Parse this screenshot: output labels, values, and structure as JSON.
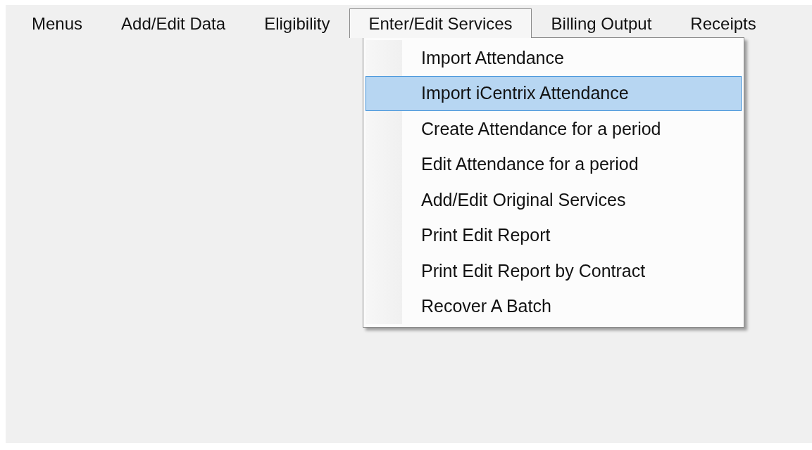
{
  "menu_bar": [
    {
      "label": "Menus",
      "selected": false
    },
    {
      "label": "Add/Edit Data",
      "selected": false
    },
    {
      "label": "Eligibility",
      "selected": false
    },
    {
      "label": "Enter/Edit Services",
      "selected": true
    },
    {
      "label": "Billing Output",
      "selected": false
    },
    {
      "label": "Receipts",
      "selected": false
    }
  ],
  "dropdown": {
    "items": [
      {
        "label": "Import Attendance",
        "selected": false
      },
      {
        "label": "Import iCentrix Attendance",
        "selected": true
      },
      {
        "label": "Create Attendance for a period",
        "selected": false
      },
      {
        "label": "Edit Attendance for a period",
        "selected": false
      },
      {
        "label": "Add/Edit Original Services",
        "selected": false
      },
      {
        "label": "Print Edit Report",
        "selected": false
      },
      {
        "label": "Print Edit Report by Contract",
        "selected": false
      },
      {
        "label": "Recover A Batch",
        "selected": false
      }
    ]
  }
}
